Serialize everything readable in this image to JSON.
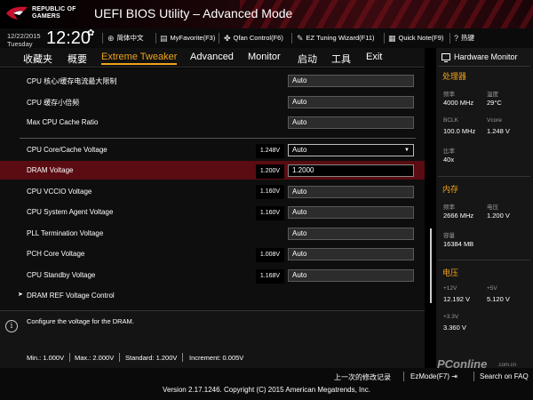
{
  "header": {
    "brand_line1": "REPUBLIC OF",
    "brand_line2": "GAMERS",
    "title": "UEFI BIOS Utility – Advanced Mode"
  },
  "infobar": {
    "date": "12/22/2015",
    "day": "Tuesday",
    "time": "12:20",
    "items": [
      {
        "icon": "globe-icon",
        "label": "简体中文"
      },
      {
        "icon": "favorite-icon",
        "label": "MyFavorite(F3)"
      },
      {
        "icon": "fan-icon",
        "label": "Qfan Control(F6)"
      },
      {
        "icon": "tuning-icon",
        "label": "EZ Tuning Wizard(F11)"
      },
      {
        "icon": "note-icon",
        "label": "Quick Note(F9)"
      },
      {
        "icon": "help-icon",
        "label": "热键"
      }
    ]
  },
  "menu": {
    "items": [
      "收藏夹",
      "概要",
      "Extreme Tweaker",
      "Advanced",
      "Monitor",
      "启动",
      "工具",
      "Exit"
    ],
    "active_index": 2
  },
  "settings": [
    {
      "label": "CPU 核心/缓存电流最大限制",
      "current": "",
      "value": "Auto"
    },
    {
      "label": "CPU 缓存小倍频",
      "current": "",
      "value": "Auto"
    },
    {
      "label": "Max CPU Cache Ratio",
      "current": "",
      "value": "Auto"
    },
    {
      "label": "CPU Core/Cache Voltage",
      "current": "1.248V",
      "value": "Auto"
    },
    {
      "label": "DRAM Voltage",
      "current": "1.200V",
      "value": "1.2000"
    },
    {
      "label": "CPU VCCIO Voltage",
      "current": "1.160V",
      "value": "Auto"
    },
    {
      "label": "CPU System Agent Voltage",
      "current": "1.160V",
      "value": "Auto"
    },
    {
      "label": "PLL Termination Voltage",
      "current": "",
      "value": "Auto"
    },
    {
      "label": "PCH Core Voltage",
      "current": "1.008V",
      "value": "Auto"
    },
    {
      "label": "CPU Standby Voltage",
      "current": "1.168V",
      "value": "Auto"
    }
  ],
  "submenu": {
    "label": "DRAM REF Voltage Control"
  },
  "help": {
    "text": "Configure the voltage for the DRAM.",
    "min": "Min.: 1.000V",
    "max": "Max.: 2.000V",
    "standard": "Standard: 1.200V",
    "increment": "Increment: 0.005V"
  },
  "hardware_monitor": {
    "title": "Hardware Monitor",
    "cpu": {
      "section": "处理器",
      "freq_label": "频率",
      "freq_value": "4000 MHz",
      "temp_label": "温度",
      "temp_value": "29°C",
      "bclk_label": "BCLK",
      "bclk_value": "100.0 MHz",
      "vcore_label": "Vcore",
      "vcore_value": "1.248 V",
      "ratio_label": "比率",
      "ratio_value": "40x"
    },
    "memory": {
      "section": "内存",
      "freq_label": "频率",
      "freq_value": "2666 MHz",
      "volt_label": "电压",
      "volt_value": "1.200 V",
      "cap_label": "容量",
      "cap_value": "16384 MB"
    },
    "voltage": {
      "section": "电压",
      "v12_label": "+12V",
      "v12_value": "12.192 V",
      "v5_label": "+5V",
      "v5_value": "5.120 V",
      "v33_label": "+3.3V",
      "v33_value": "3.360 V"
    }
  },
  "footer": {
    "last_modified": "上一次的修改记录",
    "ezmode": "EzMode(F7)",
    "search": "Search on FAQ",
    "copyright": "Version 2.17.1246. Copyright (C) 2015 American Megatrends, Inc.",
    "watermark": "PConline",
    "watermark_sub": ".com.cn"
  },
  "colors": {
    "accent": "#f2a31a",
    "selected_row": "#5a0c12",
    "brand_red": "#c8102e"
  }
}
